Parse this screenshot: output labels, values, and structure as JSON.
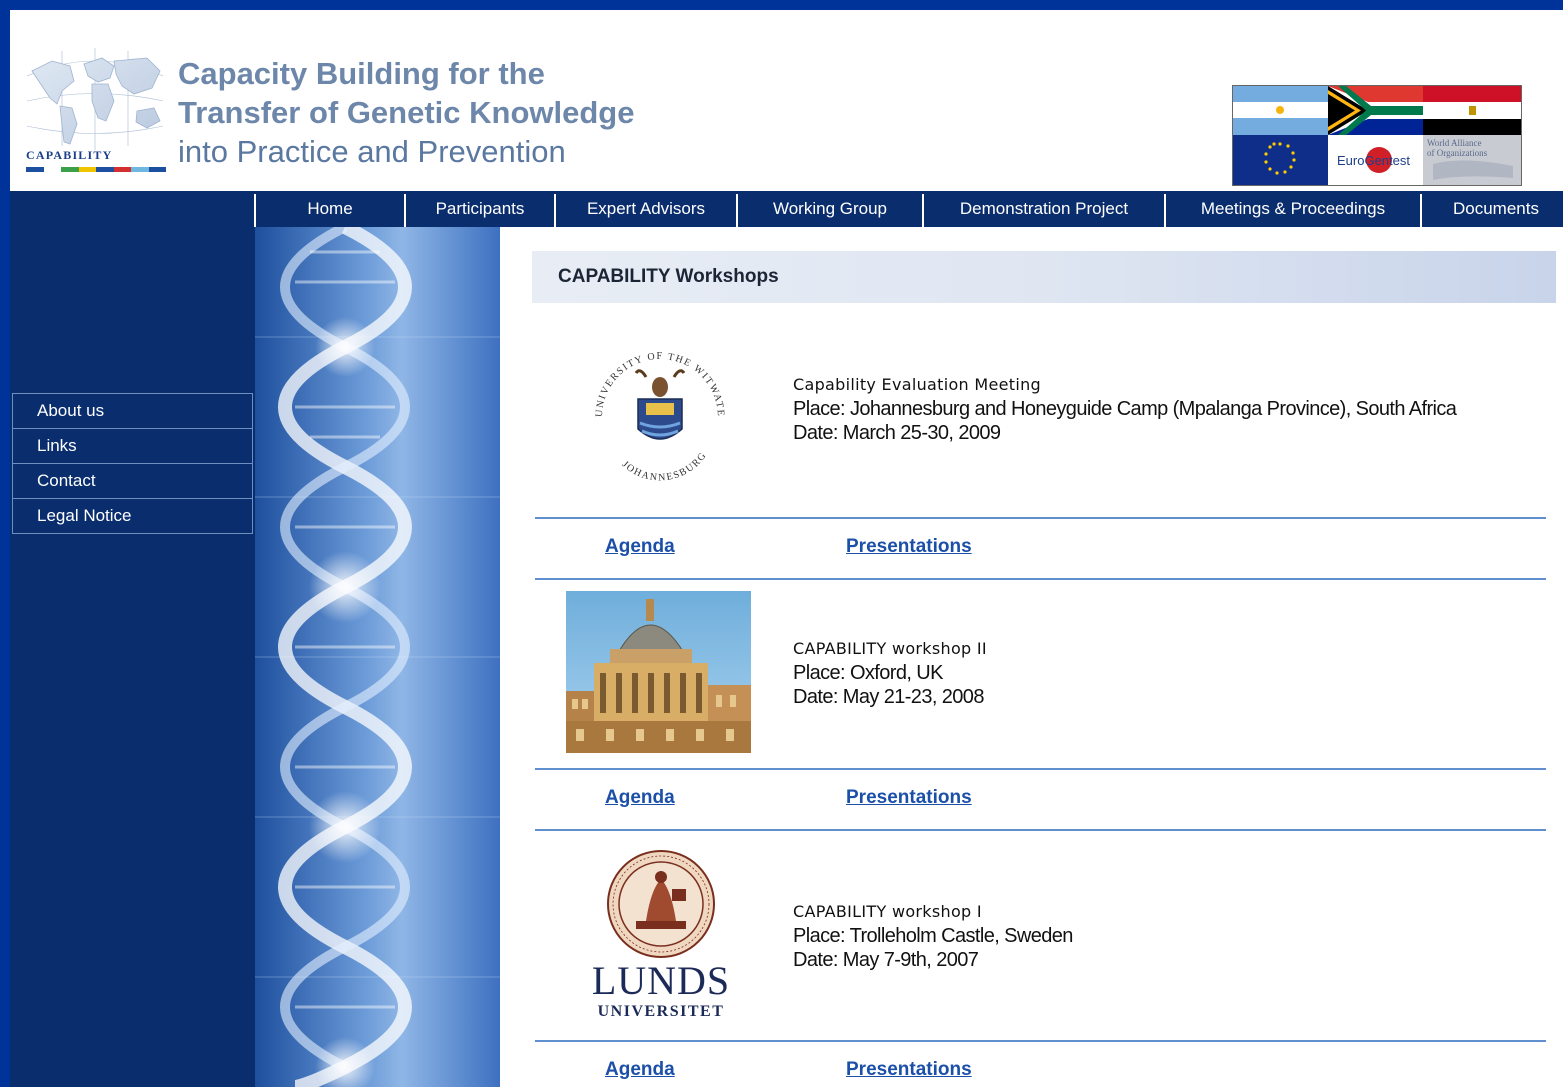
{
  "header": {
    "logo_word": "CAPABILITY",
    "title_lines": [
      "Capacity Building for the",
      "Transfer of Genetic Knowledge",
      "into Practice and Prevention"
    ],
    "partner_logos": {
      "eurogentest": "EuroGentest",
      "wao_line1": "World Alliance",
      "wao_line2": "of Organizations"
    }
  },
  "nav": {
    "items": [
      "Home",
      "Participants",
      "Expert Advisors",
      "Working Group",
      "Demonstration Project",
      "Meetings & Proceedings",
      "Documents"
    ]
  },
  "sidebar": {
    "items": [
      "About us",
      "Links",
      "Contact",
      "Legal Notice"
    ]
  },
  "content": {
    "section_title": "CAPABILITY Workshops",
    "workshops": [
      {
        "title": "Capability Evaluation Meeting",
        "place": "Place: Johannesburg and Honeyguide Camp (Mpalanga Province), South Africa",
        "date": "Date: March 25-30, 2009",
        "seal_top": "UNIVERSITY OF THE WITWATERSRAND",
        "seal_bottom": "JOHANNESBURG",
        "agenda": "Agenda",
        "presentations": "Presentations"
      },
      {
        "title": "CAPABILITY workshop II",
        "place": "Place: Oxford, UK",
        "date": "Date: May 21-23, 2008",
        "agenda": "Agenda",
        "presentations": "Presentations"
      },
      {
        "title": "CAPABILITY workshop I",
        "place": "Place: Trolleholm Castle, Sweden",
        "date": "Date: May 7-9th, 2007",
        "logo_word_1": "LUNDS",
        "logo_word_2": "UNIVERSITET",
        "agenda": "Agenda",
        "presentations": "Presentations"
      }
    ]
  },
  "colors": {
    "page_border": "#003399",
    "navy": "#0a2d6e",
    "link": "#1b4fa8",
    "rule": "#5f8fcf"
  }
}
